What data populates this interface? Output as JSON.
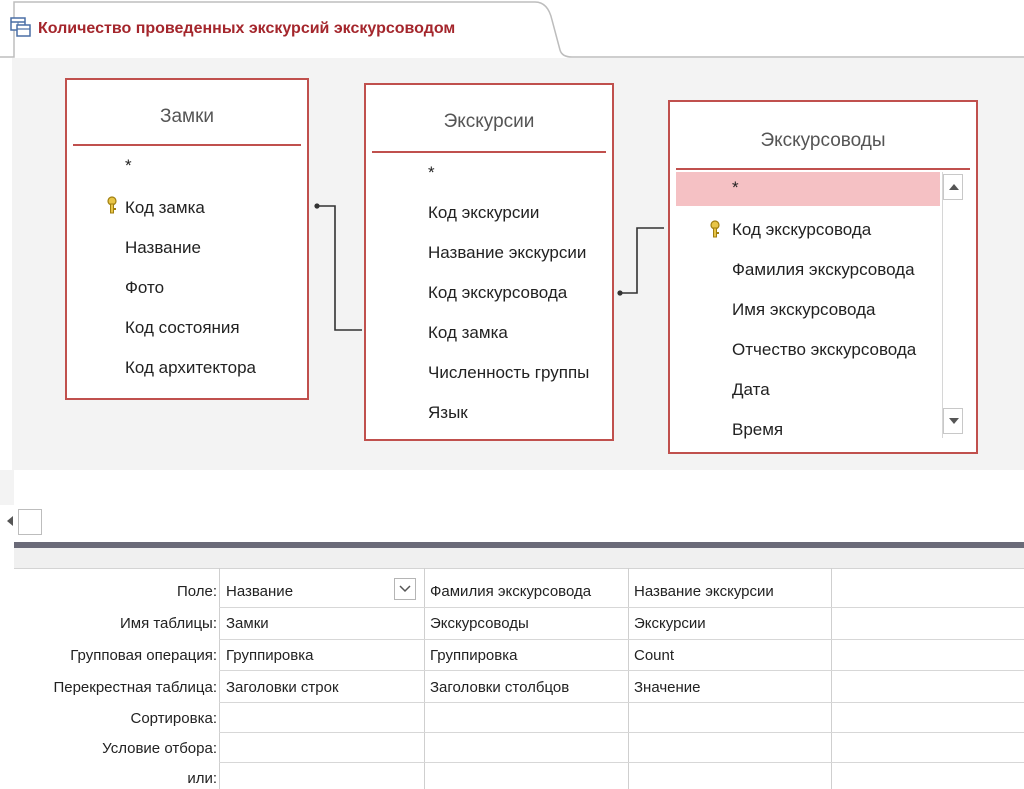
{
  "tab": {
    "title": "Количество проведенных экскурсий экскурсоводом",
    "icon": "query-icon"
  },
  "colors": {
    "accent": "#a4262c",
    "table_border": "#c0504d",
    "selected_row": "#f5c1c4"
  },
  "tables": {
    "zamki": {
      "title": "Замки",
      "fields": [
        "*",
        "Код замка",
        "Название",
        "Фото",
        "Код состояния",
        "Код архитектора"
      ],
      "key_field": "Код замка"
    },
    "ekskursii": {
      "title": "Экскурсии",
      "fields": [
        "*",
        "Код экскурсии",
        "Название экскурсии",
        "Код экскурсовода",
        "Код замка",
        "Численность группы",
        "Язык"
      ]
    },
    "ekskursovody": {
      "title": "Экскурсоводы",
      "fields": [
        "*",
        "Код экскурсовода",
        "Фамилия экскурсовода",
        "Имя экскурсовода",
        "Отчество экскурсовода",
        "Дата",
        "Время"
      ],
      "key_field": "Код экскурсовода",
      "selected_field": "*"
    }
  },
  "grid": {
    "row_labels": [
      "Поле:",
      "Имя таблицы:",
      "Групповая операция:",
      "Перекрестная таблица:",
      "Сортировка:",
      "Условие отбора:",
      "или:"
    ],
    "columns": [
      {
        "field": "Название",
        "table": "Замки",
        "group": "Группировка",
        "crosstab": "Заголовки строк",
        "sort": "",
        "criteria": "",
        "or": ""
      },
      {
        "field": "Фамилия экскурсовода",
        "table": "Экскурсоводы",
        "group": "Группировка",
        "crosstab": "Заголовки столбцов",
        "sort": "",
        "criteria": "",
        "or": ""
      },
      {
        "field": "Название экскурсии",
        "table": "Экскурсии",
        "group": "Count",
        "crosstab": "Значение",
        "sort": "",
        "criteria": "",
        "or": ""
      }
    ]
  }
}
